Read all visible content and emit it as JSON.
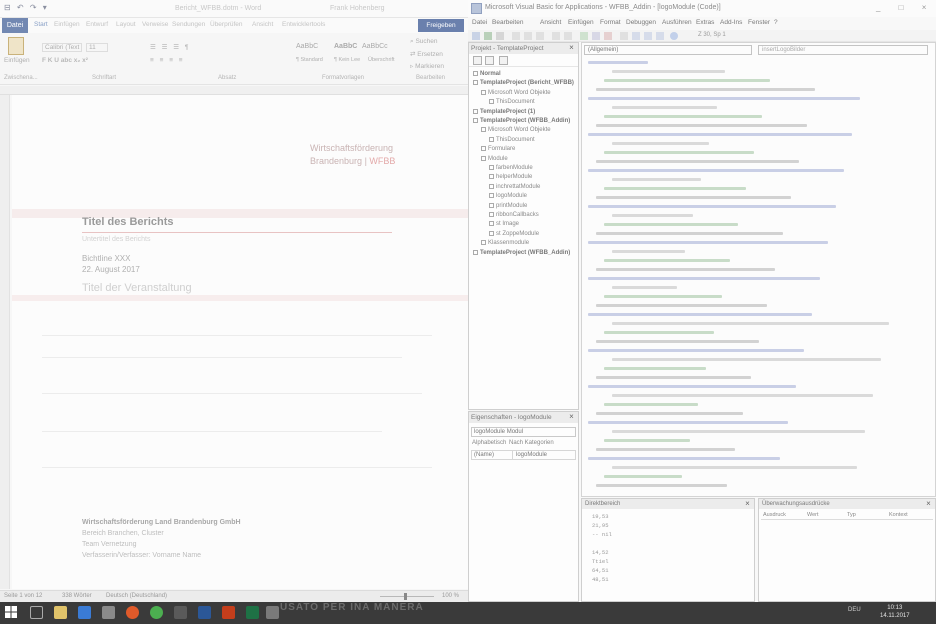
{
  "word": {
    "quick_access": "⊟ ↶ ↷ ▾",
    "doc_title": "Bericht_WFBB.dotm - Word",
    "user": "Frank Hohenberg",
    "tabs": [
      "Datei",
      "Start",
      "Einfügen",
      "Entwurf",
      "Layout",
      "Verweise",
      "Sendungen",
      "Überprüfen",
      "Ansicht",
      "Entwicklertools"
    ],
    "share": "Freigeben",
    "ribbon": {
      "paste": "Einfügen",
      "font_name": "Calibri (Text",
      "font_size": "11",
      "styles": [
        "AaBbC",
        "AaBbC",
        "AaBbCc"
      ],
      "style_names": [
        "¶ Standard",
        "¶ Kein Lee",
        "Überschrift"
      ],
      "search": "Suchen",
      "replace": "Ersetzen",
      "select": "Markieren",
      "groups": [
        "Zwischena...",
        "Schriftart",
        "Absatz",
        "Formatvorlagen",
        "Bearbeiten"
      ]
    },
    "document": {
      "logo_line1": "Wirtschaftsförderung",
      "logo_line2": "Brandenburg",
      "logo_sep": "|",
      "logo_brand": "WFBB",
      "title": "Titel des Berichts",
      "subtitle": "Untertitel des Berichts",
      "bichtline": "Bichtline XXX",
      "date": "22. August 2017",
      "event": "Titel der Veranstaltung",
      "company": "Wirtschaftsförderung Land Brandenburg GmbH",
      "footer_lines": [
        "Bereich Branchen, Cluster",
        "Team Vernetzung",
        "Verfasserin/Verfasser: Vorname Name"
      ]
    },
    "status": {
      "page": "Seite 1 von 12",
      "words": "338 Wörter",
      "lang": "Deutsch (Deutschland)",
      "zoom": "100 %",
      "zoom_value": 100
    }
  },
  "vba": {
    "title": "Microsoft Visual Basic for Applications - WFBB_Addin - [logoModule (Code)]",
    "win_buttons": "_ □ ×",
    "menu": [
      "Datei",
      "Bearbeiten",
      "Ansicht",
      "Einfügen",
      "Format",
      "Debuggen",
      "Ausführen",
      "Extras",
      "Add-Ins",
      "Fenster",
      "?"
    ],
    "position": "Z 30, Sp 1",
    "project_header": "Projekt - TemplateProject",
    "tree": [
      {
        "label": "Normal",
        "level": 0,
        "bold": true
      },
      {
        "label": "TemplateProject (Bericht_WFBB)",
        "level": 0,
        "bold": true
      },
      {
        "label": "Microsoft Word Objekte",
        "level": 1,
        "bold": false
      },
      {
        "label": "ThisDocument",
        "level": 2,
        "bold": false
      },
      {
        "label": "TemplateProject (1)",
        "level": 0,
        "bold": true
      },
      {
        "label": "TemplateProject (WFBB_Addin)",
        "level": 0,
        "bold": true
      },
      {
        "label": "Microsoft Word Objekte",
        "level": 1,
        "bold": false
      },
      {
        "label": "ThisDocument",
        "level": 2,
        "bold": false
      },
      {
        "label": "Formulare",
        "level": 1,
        "bold": false
      },
      {
        "label": "Module",
        "level": 1,
        "bold": false
      },
      {
        "label": "farbenModule",
        "level": 2,
        "bold": false
      },
      {
        "label": "helperModule",
        "level": 2,
        "bold": false
      },
      {
        "label": "inchrettatModule",
        "level": 2,
        "bold": false
      },
      {
        "label": "logoModule",
        "level": 2,
        "bold": false
      },
      {
        "label": "printModule",
        "level": 2,
        "bold": false
      },
      {
        "label": "ribbonCallbacks",
        "level": 2,
        "bold": false
      },
      {
        "label": "st Image",
        "level": 2,
        "bold": false
      },
      {
        "label": "st ZoppeModule",
        "level": 2,
        "bold": false
      },
      {
        "label": "Klassenmodule",
        "level": 1,
        "bold": false
      },
      {
        "label": "TemplateProject (WFBB_Addin)",
        "level": 0,
        "bold": true
      }
    ],
    "props_header": "Eigenschaften - logoModule",
    "props_object": "logoModule Modul",
    "props_tabs": [
      "Alphabetisch",
      "Nach Kategorien"
    ],
    "props_row": {
      "name": "(Name)",
      "value": "logoModule"
    },
    "code_object": "(Allgemein)",
    "code_proc": "insertLogoBilder",
    "immediate_header": "Direktbereich",
    "immediate_lines": [
      "19,53",
      "21,95",
      "-- nil",
      "",
      "14,52",
      "Ttiel",
      "64,51",
      "48,51"
    ],
    "locals_header": "Überwachungsausdrücke",
    "locals_cols": [
      "Ausdruck",
      "Wert",
      "Typ",
      "Kontext"
    ]
  },
  "taskbar": {
    "lang": "DEU",
    "time": "10:13",
    "date": "14.11.2017",
    "ghost_text": "USATO PER      INA MANERA"
  }
}
